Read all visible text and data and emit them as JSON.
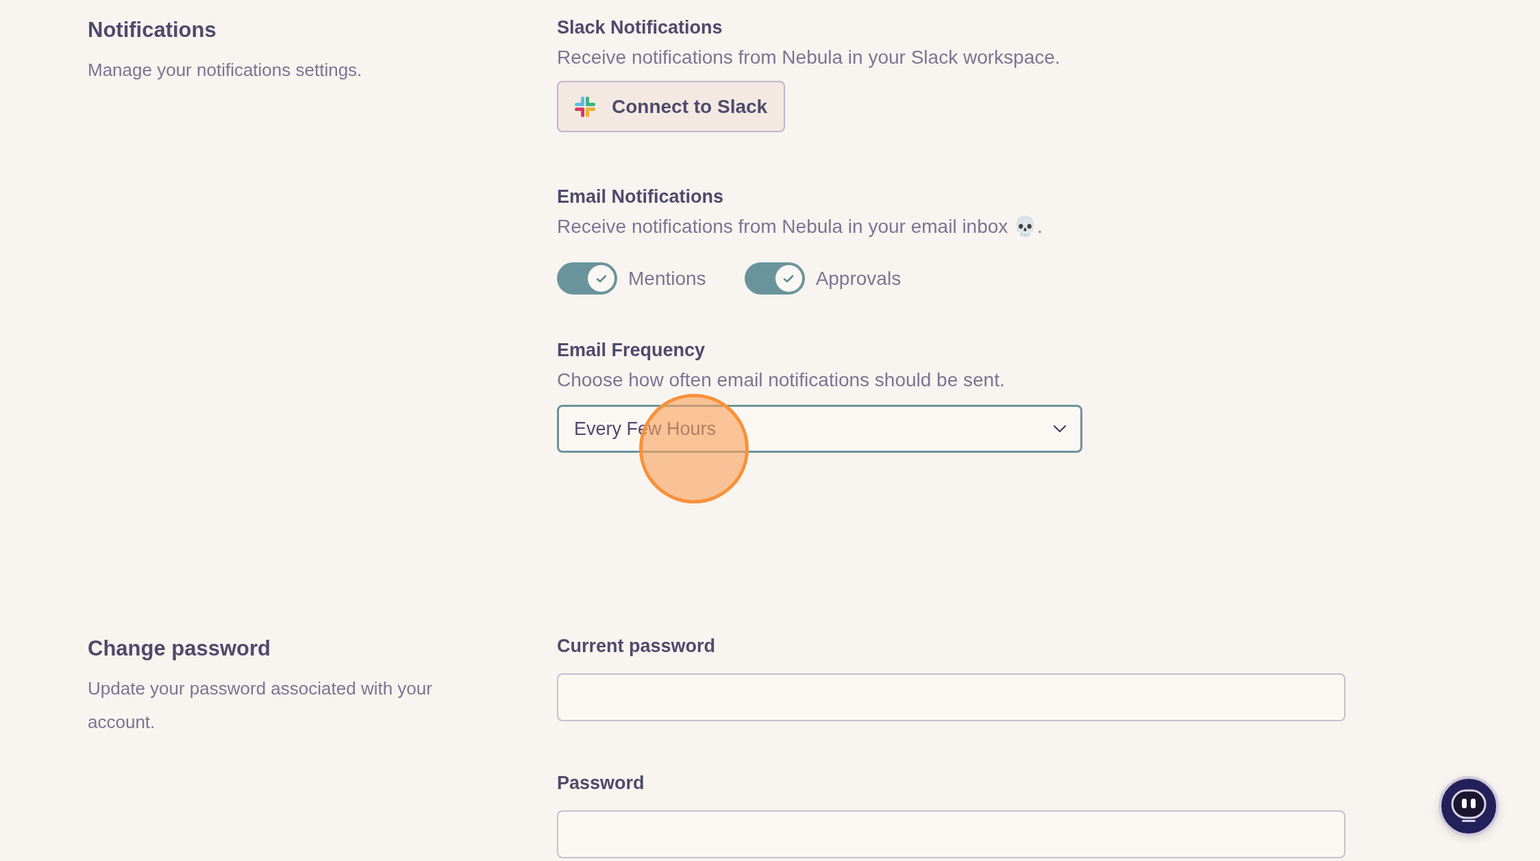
{
  "sections": [
    {
      "kind": "notifications",
      "title": "Notifications",
      "description": "Manage your notifications settings.",
      "slack": {
        "label": "Slack Notifications",
        "description": "Receive notifications from Nebula in your Slack workspace.",
        "button": "Connect to Slack"
      },
      "email": {
        "label": "Email Notifications",
        "description": "Receive notifications from Nebula in your email inbox 💀.",
        "toggles": [
          {
            "label": "Mentions",
            "checked": true
          },
          {
            "label": "Approvals",
            "checked": true
          }
        ]
      },
      "frequency": {
        "label": "Email Frequency",
        "description": "Choose how often email notifications should be sent.",
        "value": "Every Few Hours"
      }
    },
    {
      "kind": "password",
      "title": "Change password",
      "description": "Update your password associated with your account.",
      "fields": [
        {
          "label": "Current password"
        },
        {
          "label": "Password"
        }
      ]
    }
  ]
}
